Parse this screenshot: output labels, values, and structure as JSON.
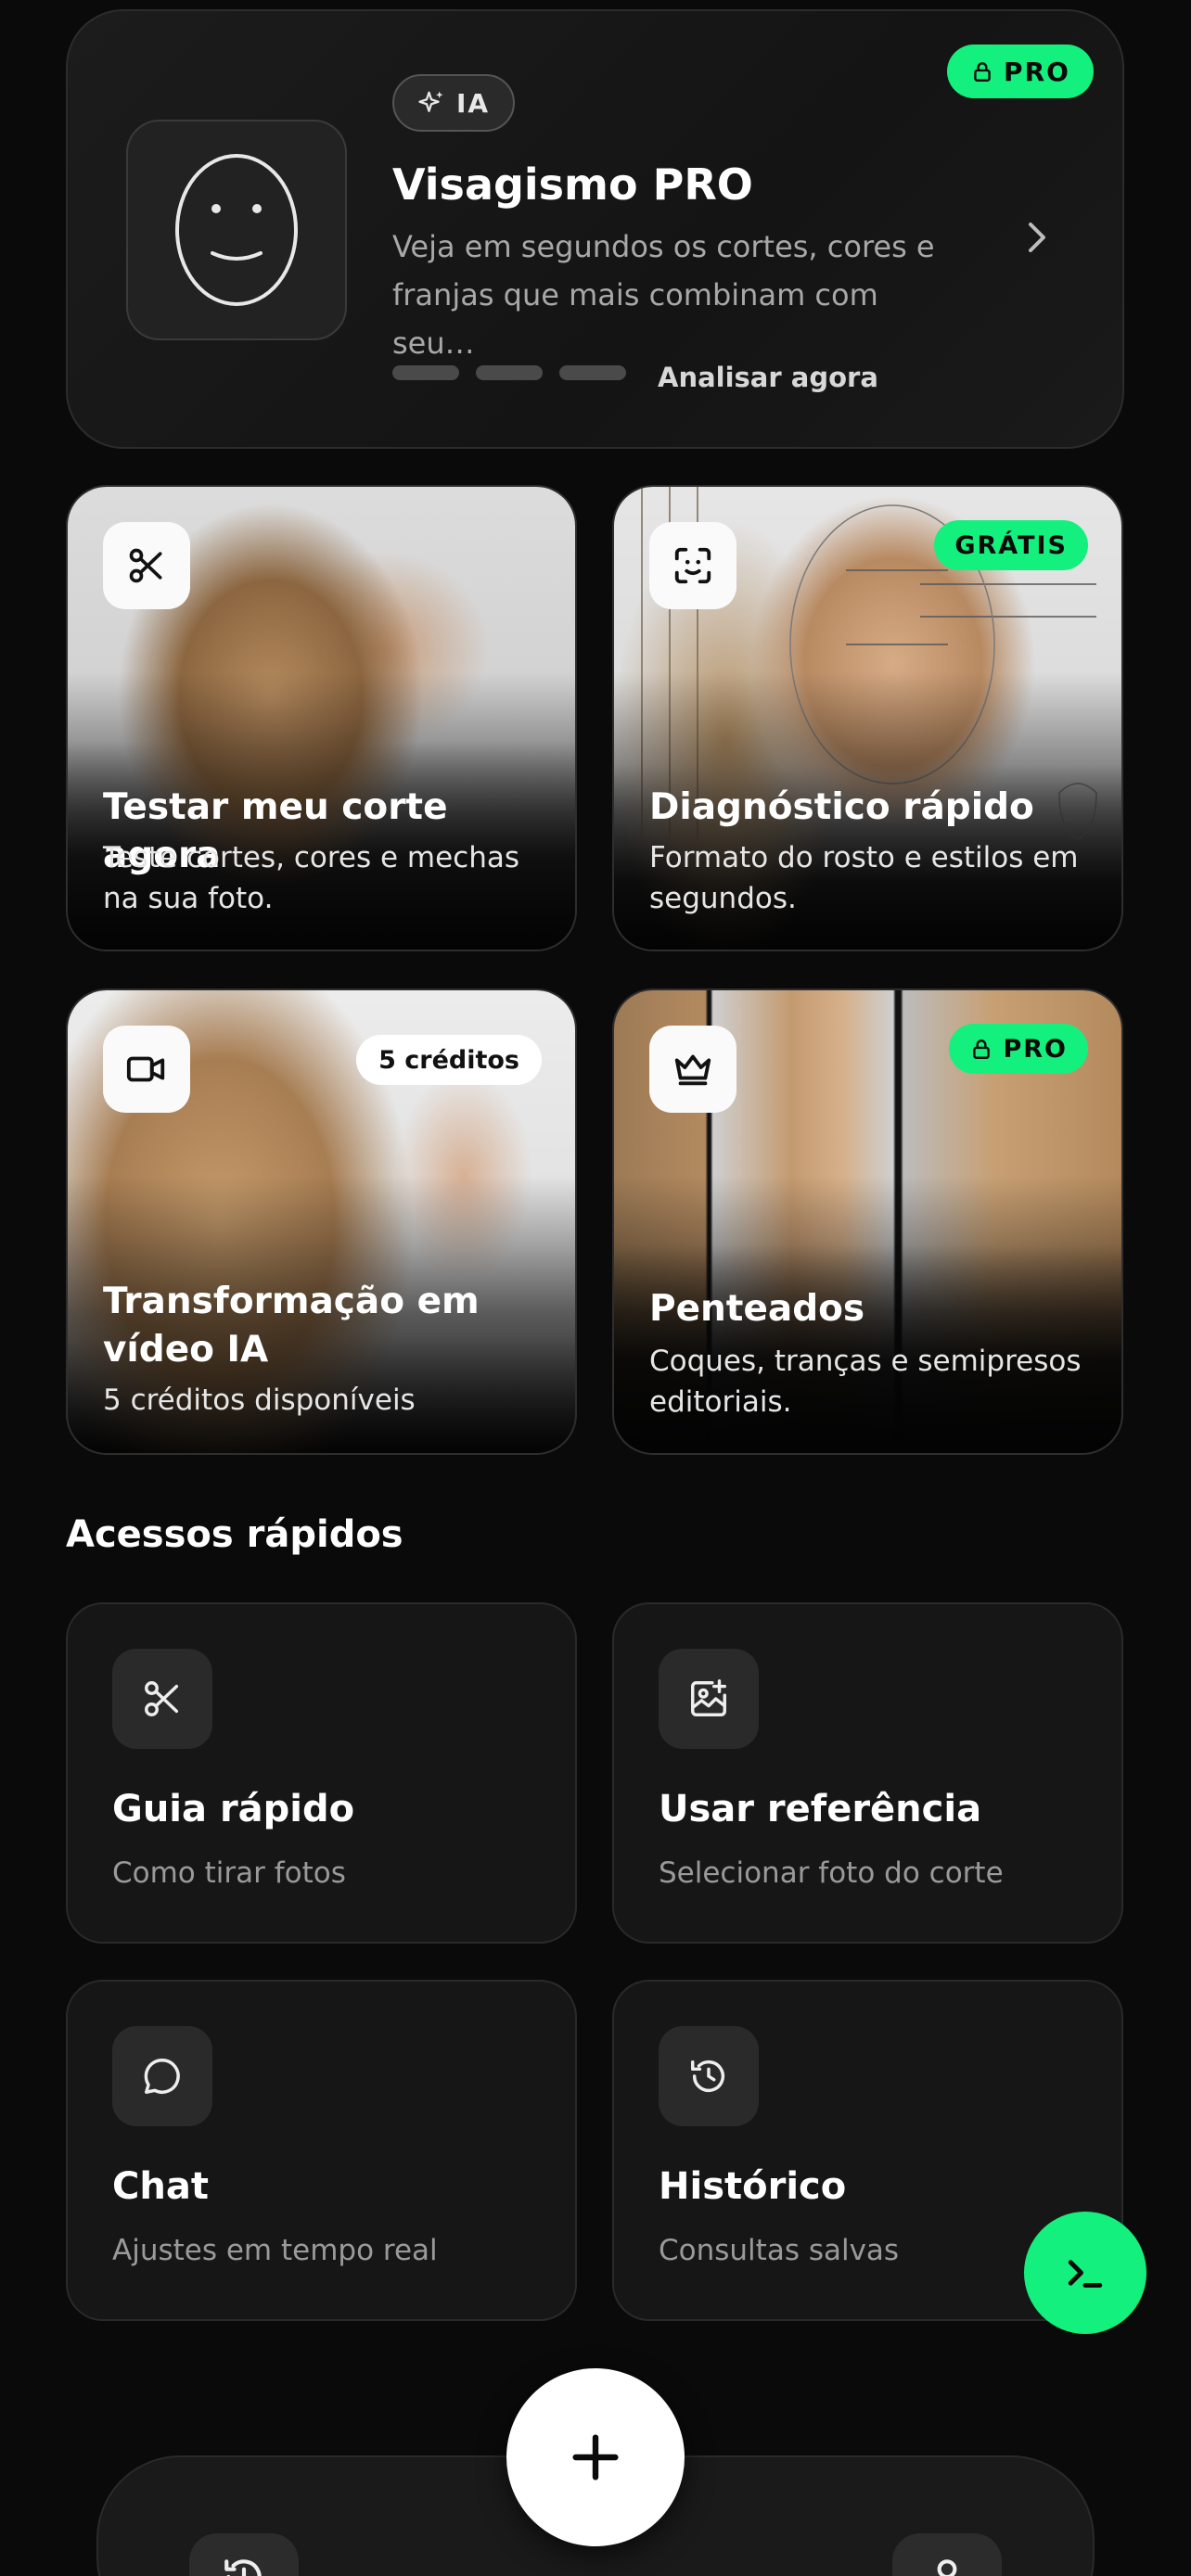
{
  "hero": {
    "ia_label": "IA",
    "pro_label": "PRO",
    "title": "Visagismo PRO",
    "description": "Veja em segundos os cortes, cores e franjas que mais combinam com seu…",
    "cta": "Analisar agora"
  },
  "features": [
    {
      "title": "Testar meu corte agora",
      "description": "Teste cortes, cores e mechas na sua foto.",
      "icon": "scissors-icon"
    },
    {
      "title": "Diagnóstico rápido",
      "description": "Formato do rosto e estilos em segundos.",
      "badge": "GRÁTIS",
      "icon": "face-scan-icon"
    },
    {
      "title": "Transformação em vídeo IA",
      "description": "5 créditos disponíveis",
      "badge": "5 créditos",
      "icon": "video-icon"
    },
    {
      "title": "Penteados",
      "description": "Coques, tranças e semipresos editoriais.",
      "badge": "PRO",
      "icon": "crown-icon"
    }
  ],
  "quick_access": {
    "title": "Acessos rápidos",
    "items": [
      {
        "title": "Guia rápido",
        "description": "Como tirar fotos",
        "icon": "scissors-icon"
      },
      {
        "title": "Usar referência",
        "description": "Selecionar foto do corte",
        "icon": "image-plus-icon"
      },
      {
        "title": "Chat",
        "description": "Ajustes em tempo real",
        "icon": "chat-bubble-icon"
      },
      {
        "title": "Histórico",
        "description": "Consultas salvas",
        "icon": "history-icon"
      }
    ]
  },
  "colors": {
    "accent": "#14f07e",
    "background": "#0a0a0a",
    "card": "#161616"
  }
}
